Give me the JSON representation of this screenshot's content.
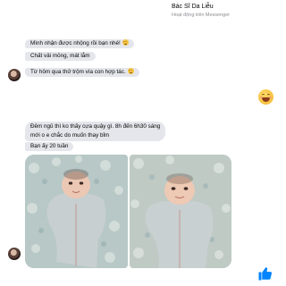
{
  "header": {
    "title": "Bác Sĩ Da Liễu",
    "subtitle": "Hoạt động trên Messenger"
  },
  "messages": [
    {
      "text": "Mình nhận được nhộng rồi bạn nhé!",
      "emoji": "smile"
    },
    {
      "text": "Chất vải mỏng, mát lắm"
    },
    {
      "text": "Từ hôm qua thử trộm vía con hợp tác.",
      "emoji": "smile"
    },
    {
      "line1": "Đêm ngủ thì ko thấy cựa quậy gì. 8h đến 6h30 sáng",
      "line2": "mới o e chắc do muốn thay bỉm"
    },
    {
      "text": "Bạn ấy 20 tuần"
    }
  ],
  "reactions": {
    "reply_emoji": "grinning-face-with-smiling-eyes",
    "send_button": "thumbs-up"
  },
  "colors": {
    "bubble_bg": "#e4e6eb",
    "text": "#050505",
    "muted": "#8a8d91",
    "accent": "#0084ff"
  }
}
